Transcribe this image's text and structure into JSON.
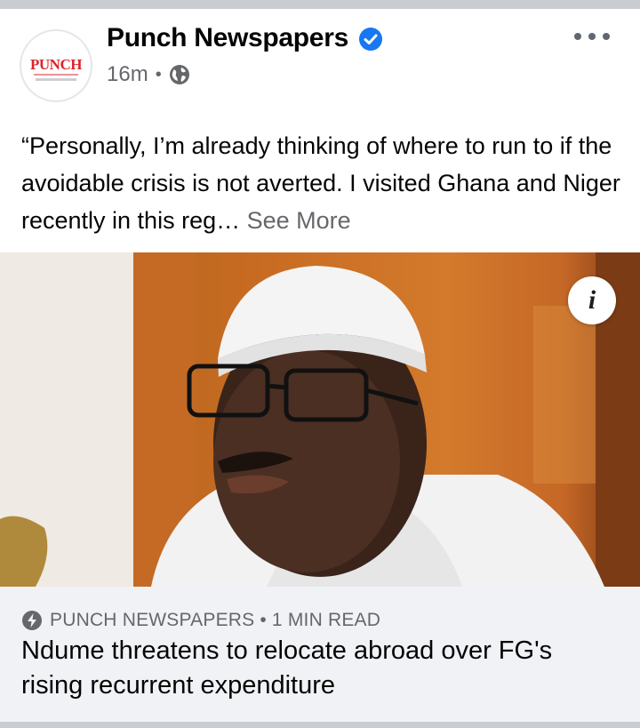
{
  "post": {
    "page_name": "Punch Newspapers",
    "time": "16m",
    "separator": "•",
    "text": "“Personally, I’m already thinking of where to run to if the avoidable crisis is not averted. I visited Ghana and Niger recently in this reg…",
    "see_more": "See More",
    "avatar_logo": "PUNCH",
    "icons": {
      "verified": "verified-badge-icon",
      "privacy": "globe-icon",
      "options": "more-options-icon",
      "info": "info-icon"
    }
  },
  "link_card": {
    "source": "PUNCH NEWSPAPERS",
    "separator": "•",
    "read_time": "1 MIN READ",
    "headline": "Ndume threatens to relocate abroad over FG's rising recurrent expenditure",
    "icon": "lightning-bolt-icon"
  },
  "colors": {
    "verified": "#1877f2",
    "secondary_text": "#65676b",
    "card_bg": "#f0f2f5",
    "punch_red": "#d9252a"
  }
}
